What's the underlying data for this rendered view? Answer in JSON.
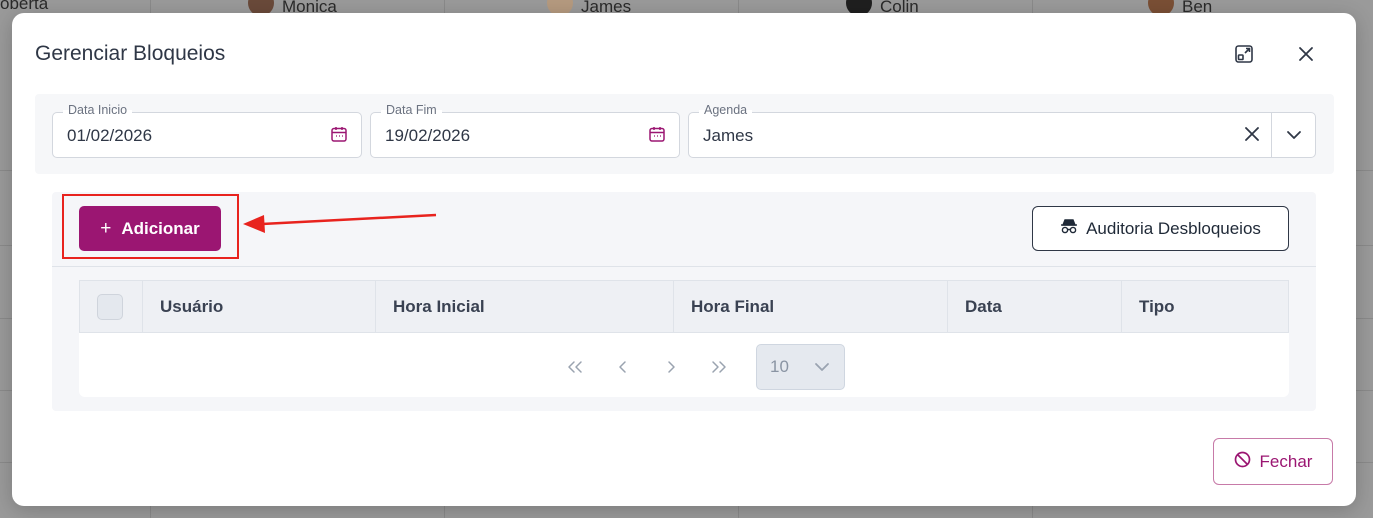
{
  "background": {
    "calendar_names": [
      "oberta",
      "Monica",
      "James",
      "Colin",
      "Ben"
    ]
  },
  "modal": {
    "title": "Gerenciar Bloqueios",
    "filters": {
      "start_date": {
        "label": "Data Inicio",
        "value": "01/02/2026"
      },
      "end_date": {
        "label": "Data Fim",
        "value": "19/02/2026"
      },
      "agenda": {
        "label": "Agenda",
        "value": "James"
      }
    },
    "toolbar": {
      "add_label": "Adicionar",
      "audit_label": "Auditoria Desbloqueios"
    },
    "table": {
      "columns": [
        "Usuário",
        "Hora Inicial",
        "Hora Final",
        "Data",
        "Tipo"
      ]
    },
    "pagination": {
      "page_size": "10"
    },
    "footer": {
      "close_label": "Fechar"
    }
  },
  "colors": {
    "primary": "#9b1672",
    "annotation": "#e8231e"
  }
}
